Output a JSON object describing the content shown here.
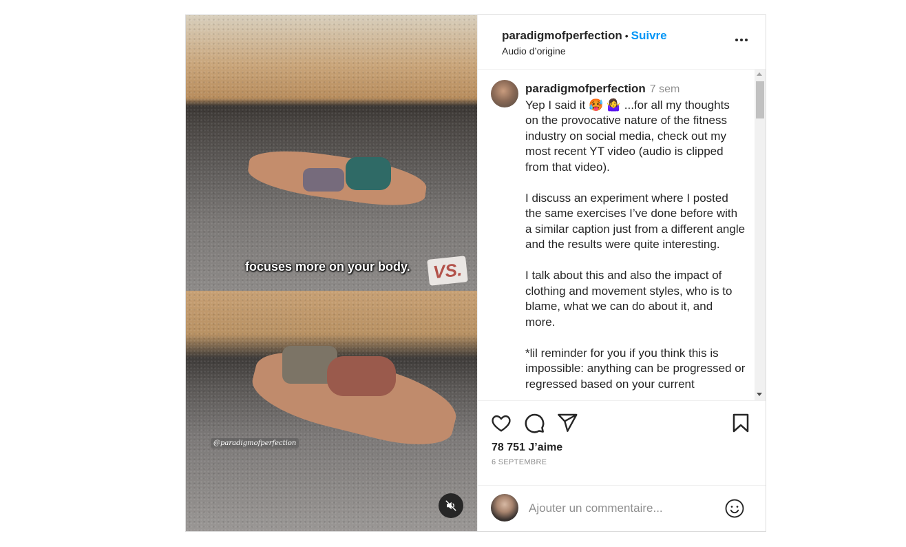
{
  "header": {
    "username": "paradigmofperfection",
    "separator": "•",
    "follow_label": "Suivre",
    "audio_label": "Audio d’origine"
  },
  "media": {
    "overlay_text": "focuses more on your body.",
    "vs_label": "VS.",
    "watermark": "@paradigmofperfection"
  },
  "caption": {
    "username": "paradigmofperfection",
    "time": "7 sem",
    "paragraphs": [
      "Yep I said it 🥵 🤷‍♀️ ...for all my thoughts on the provocative nature of the fitness industry on social media, check out my most recent YT video (audio is clipped from that video).",
      "I discuss an experiment where I posted the same exercises I’ve done before with a similar caption just from a different angle and the results were quite interesting.",
      "I talk about this and also the impact of clothing and movement styles, who is to blame, what we can do about it, and more.",
      "*lil reminder for you if you think this is impossible: anything can be progressed or regressed based on your current"
    ]
  },
  "actions": {
    "likes": "78 751 J’aime",
    "date": "6 SEPTEMBRE"
  },
  "comment": {
    "placeholder": "Ajouter un commentaire..."
  },
  "icons": {
    "like": "heart-icon",
    "comment": "comment-icon",
    "share": "paper-plane-icon",
    "save": "bookmark-icon",
    "more": "more-options-icon",
    "mute": "muted-speaker-icon",
    "emoji": "smiley-icon"
  },
  "colors": {
    "link": "#0095f6",
    "text": "#262626",
    "secondary": "#8e8e8e"
  }
}
